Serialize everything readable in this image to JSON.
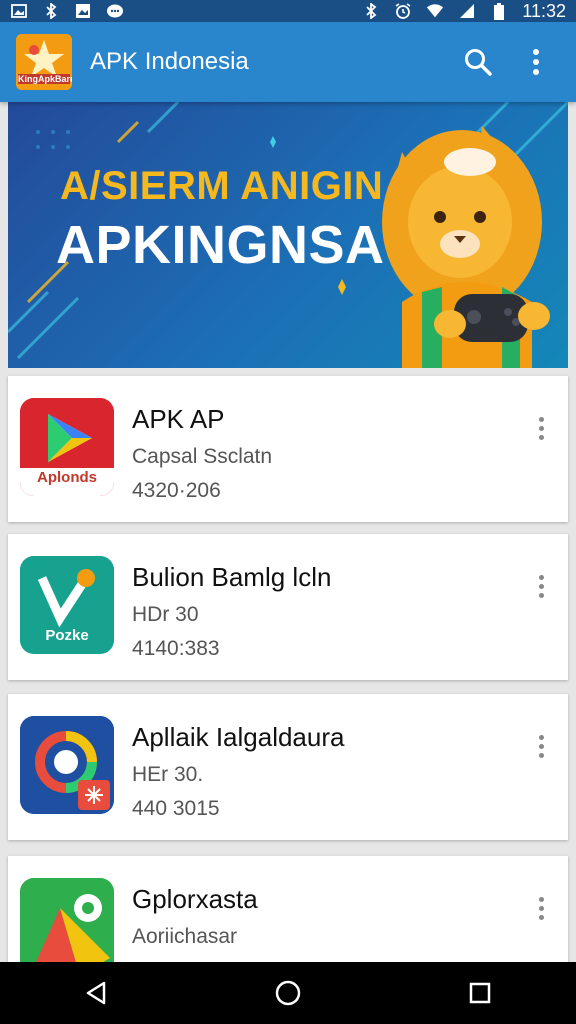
{
  "status_bar": {
    "time": "11:32",
    "left_icons": [
      "image-icon",
      "bluetooth-icon",
      "gallery-icon",
      "chat-icon"
    ],
    "right_icons": [
      "bluetooth-icon",
      "alarm-icon",
      "wifi-icon",
      "signal-icon",
      "battery-icon"
    ]
  },
  "app_bar": {
    "title": "APK Indonesia",
    "logo_text": "KingApkBaru",
    "actions": [
      "search-icon",
      "more-vert-icon"
    ]
  },
  "banner": {
    "line1": "A/SIERM ANIGIN",
    "line2": "APKINGNSA"
  },
  "apps": [
    {
      "name": "APK AP",
      "subtitle": "Capsal Ssclatn",
      "meta": "4320·206",
      "icon_label": "Aplonds"
    },
    {
      "name": "Bulion Bamlg lcln",
      "subtitle": "HDr 30",
      "meta": "4140:383",
      "icon_label": "Pozke"
    },
    {
      "name": "Apllaik Ialgaldaura",
      "subtitle": "HEr 30.",
      "meta": "440 3015",
      "icon_label": ""
    },
    {
      "name": "Gplorxasta",
      "subtitle": "Aoriichasar",
      "meta": "",
      "icon_label": ""
    }
  ],
  "colors": {
    "status_bar": "#1a4f86",
    "app_bar": "#2a86cc",
    "banner_gold": "#f5b91f"
  },
  "nav_bar": [
    "back-icon",
    "home-icon",
    "recents-icon"
  ]
}
